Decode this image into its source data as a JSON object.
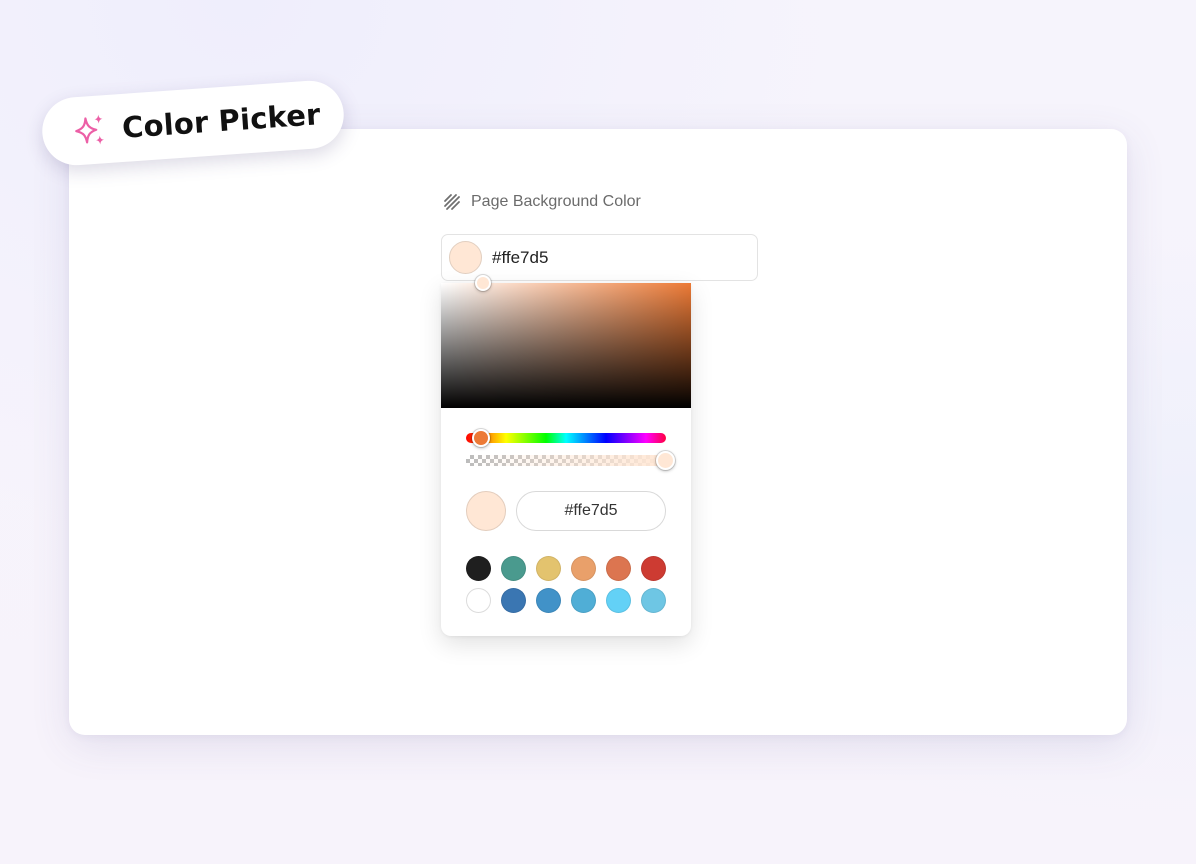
{
  "badge": {
    "title": "Color Picker",
    "icon": "sparkle-icon",
    "icon_color": "#ec5fa6"
  },
  "field": {
    "label": "Page Background Color",
    "label_icon": "hatch-pattern-icon",
    "value": "#ffe7d5"
  },
  "picker": {
    "current_color": "#ffe7d5",
    "hue_color": "#ec7a36",
    "hex_value": "#ffe7d5",
    "hue_level": 0.075,
    "alpha_level": 1.0,
    "swatches": [
      "#1f1f1f",
      "#4a9a8e",
      "#e3c36e",
      "#e9a06a",
      "#dc7550",
      "#cd3b32",
      "#ffffff",
      "#3a76b2",
      "#4192c8",
      "#50aed6",
      "#63d1f6",
      "#6ec6e4"
    ]
  }
}
